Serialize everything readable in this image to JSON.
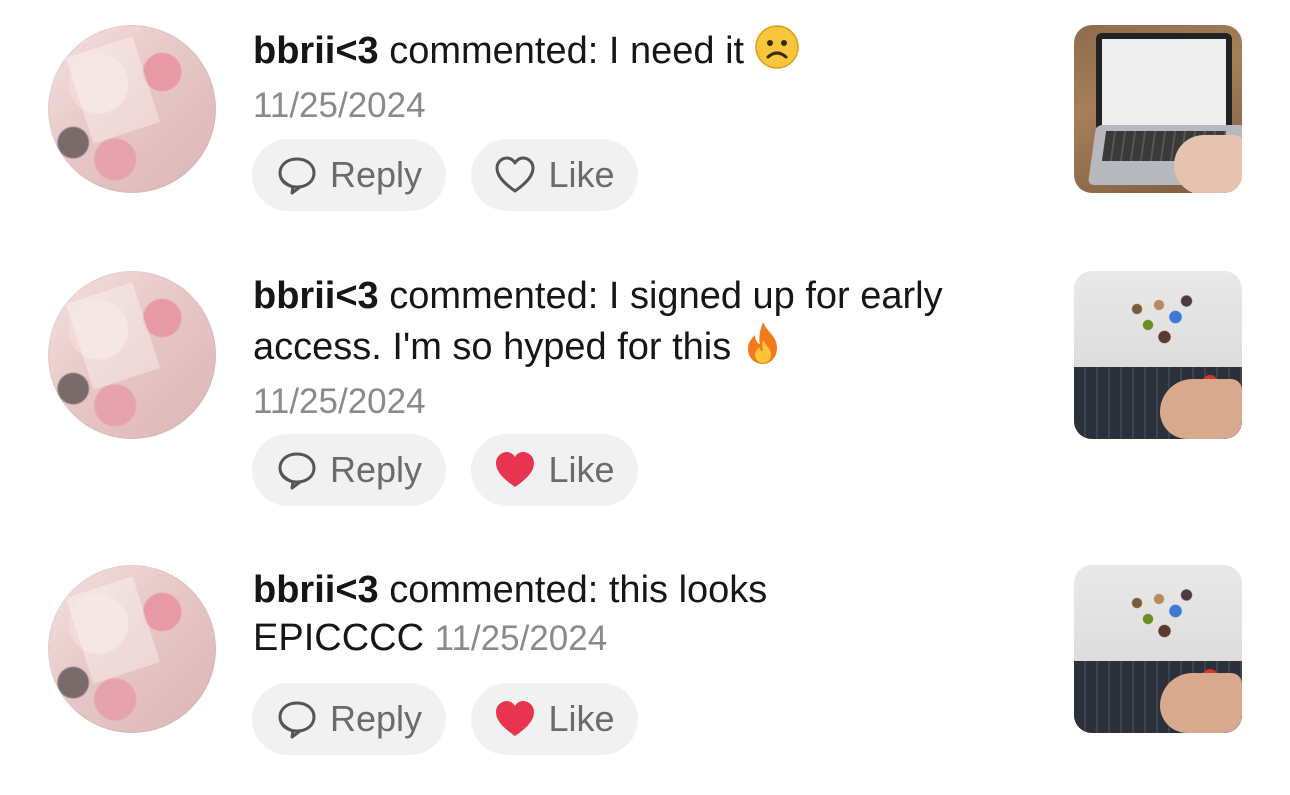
{
  "comments": [
    {
      "username": "bbrii<3",
      "action": "commented:",
      "text": "I need it",
      "emoji": "frowning-face",
      "date": "11/25/2024",
      "reply_label": "Reply",
      "like_label": "Like",
      "liked": false,
      "thumbnail": "laptop-video-thumbnail"
    },
    {
      "username": "bbrii<3",
      "action": "commented:",
      "text": "I signed up for early access. I'm so hyped for this",
      "emoji": "fire",
      "date": "11/25/2024",
      "reply_label": "Reply",
      "like_label": "Like",
      "liked": true,
      "thumbnail": "laptop-collage-video-thumbnail"
    },
    {
      "username": "bbrii<3",
      "action": "commented:",
      "text": "this looks EPICCCC",
      "emoji": "",
      "date": "11/25/2024",
      "reply_label": "Reply",
      "like_label": "Like",
      "liked": true,
      "thumbnail": "laptop-collage-video-thumbnail"
    }
  ],
  "colors": {
    "liked_heart": "#e8344e",
    "button_bg": "#f1f1f2",
    "date_text": "#8a8a8a"
  }
}
